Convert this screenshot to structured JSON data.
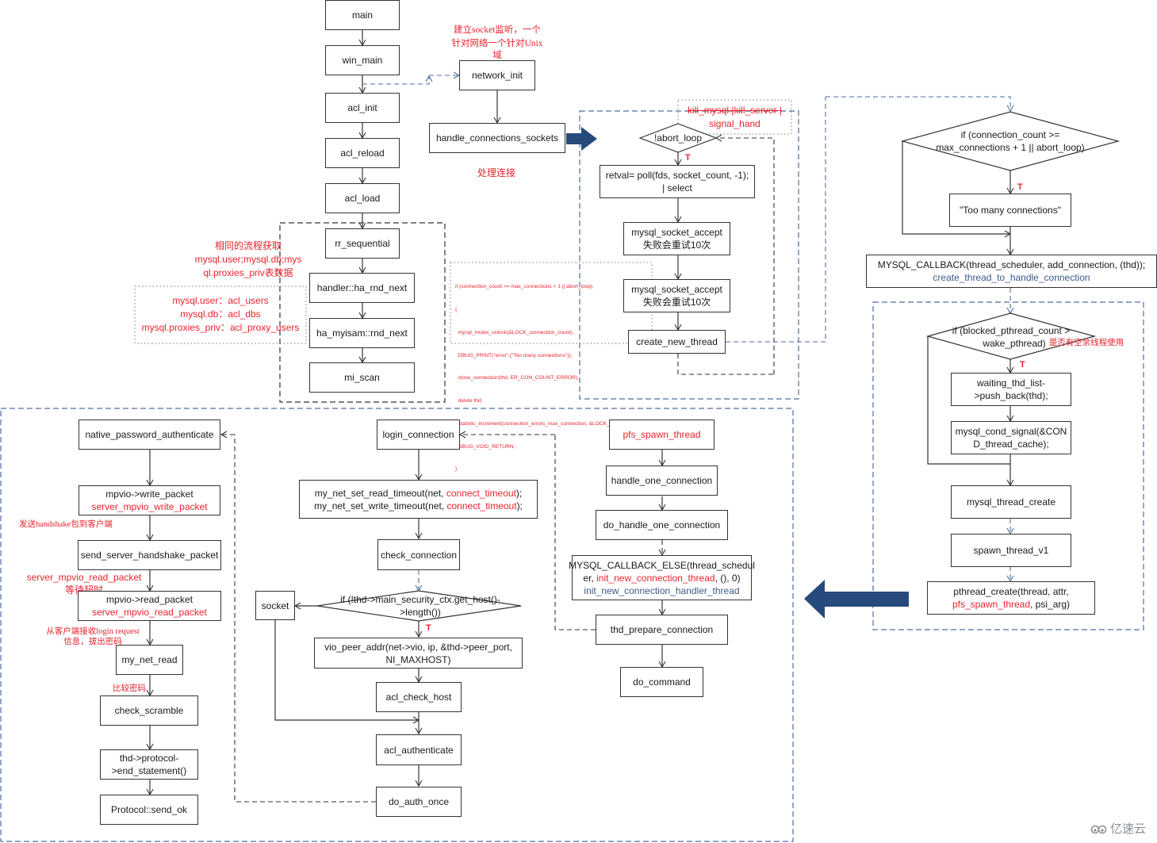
{
  "colors": {
    "text": "#1a1a1a",
    "red": "#e8232d",
    "blue": "#3b5b86",
    "arrow": "#264a7c",
    "line": "#333333",
    "group_border_blue": "#4f6fa0"
  },
  "startup": {
    "main": "main",
    "win_main": "win_main",
    "acl_init": "acl_init",
    "acl_reload": "acl_reload",
    "acl_load": "acl_load",
    "rr_sequential": "rr_sequential",
    "ha_rnd_next": "handler::ha_rnd_next",
    "rnd_next": "ha_myisam::rnd_next",
    "mi_scan": "mi_scan",
    "network_init": "network_init",
    "handle_connections_sockets": "handle_connections_sockets"
  },
  "notes": {
    "network_init_note": [
      "建立socket监听，一个",
      "针对网络一个针对Unix",
      "域"
    ],
    "handle_note": "处理连接",
    "acl_same_flow": [
      "相同的流程获取",
      "mysql.user;mysql.db;mys",
      "ql.proxies_priv表数据"
    ],
    "acl_mapping": [
      "mysql.user：acl_users",
      "mysql.db：acl_dbs",
      "mysql.proxies_priv：acl_proxy_users"
    ],
    "kill_note_line1": "kill_mysql |kill_server |",
    "kill_note_line2": "signal_hand",
    "code_snippet": [
      "if (connection_count >= max_connections + 1 || abort_loop)",
      "{",
      "  mysql_mutex_unlock(&LOCK_connection_count);",
      "  DBUG_PRINT(\"error\",(\"Too many connections\"));",
      "  close_connection(thd, ER_CON_COUNT_ERROR);",
      "  delete thd;",
      "  statistic_increment(connection_errors_max_connection, &LOCK_status);",
      "  DBUG_VOID_RETURN;",
      "}"
    ],
    "idle_thread_note": "是否有空余线程使用",
    "send_handshake_note": "发送handshake包到客户端",
    "read_packet_blue": "server_mpvio_read_packet",
    "read_packet_wait": "等待超时",
    "recv_login_note": [
      "从客户端接收login request",
      "信息，拔出密码"
    ],
    "compare_pwd_note": "比较密码"
  },
  "loop": {
    "abort_loop": "!abort_loop",
    "t_label": "T",
    "poll": [
      "retval= poll(fds, socket_count, -1);",
      "| select"
    ],
    "accept1": [
      "mysql_socket_accept",
      "失败会重试10次"
    ],
    "accept2": [
      "mysql_socket_accept",
      "失败会重试10次"
    ],
    "create_new_thread": "create_new_thread"
  },
  "scheduler": {
    "cond": [
      "if (connection_count >=",
      "max_connections + 1 || abort_loop)"
    ],
    "too_many": "\"Too many connections\"",
    "callback_line1": "MYSQL_CALLBACK(thread_scheduler, add_connection, (thd));",
    "callback_line2": "create_thread_to_handle_connection",
    "blocked_cond": [
      "if (blocked_pthread_count >",
      "wake_pthread)"
    ],
    "push_back": [
      "waiting_thd_list-",
      ">push_back(thd);"
    ],
    "cond_signal": [
      "mysql_cond_signal(&CON",
      "D_thread_cache);"
    ],
    "thread_create": "mysql_thread_create",
    "spawn_v1": "spawn_thread_v1",
    "pthread_create_a": "pthread_create(thread, attr,",
    "pthread_create_red": "pfs_spawn_thread",
    "pthread_create_b": ", psi_arg)"
  },
  "thread": {
    "pfs_spawn_thread": "pfs_spawn_thread",
    "handle_one": "handle_one_connection",
    "do_handle_one": "do_handle_one_connection",
    "cb_else_a": "MYSQL_CALLBACK_ELSE(thread_schedul",
    "cb_else_b1": "er, ",
    "cb_else_b_red": "init_new_connection_thread",
    "cb_else_b2": ", (), 0)",
    "cb_else_c": "init_new_connection_handler_thread",
    "thd_prepare": "thd_prepare_connection",
    "do_command": "do_command"
  },
  "login": {
    "login_connection": "login_connection",
    "timeout_read_a": "my_net_set_read_timeout(net, ",
    "timeout_write_a": "my_net_set_write_timeout(net, ",
    "timeout_red": "connect_timeout",
    "timeout_end": ");",
    "check_connection": "check_connection",
    "host_cond": [
      "if (!thd->main_security_ctx.get_host()-",
      ">length())"
    ],
    "socket": "socket",
    "vio_peer": [
      "vio_peer_addr(net->vio, ip, &thd->peer_port,",
      "NI_MAXHOST)"
    ],
    "acl_check_host": "acl_check_host",
    "acl_authenticate": "acl_authenticate",
    "do_auth_once": "do_auth_once"
  },
  "auth": {
    "native": "native_password_authenticate",
    "write_packet": "mpvio->write_packet",
    "write_packet_red": "server_mpvio_write_packet",
    "send_handshake": "send_server_handshake_packet",
    "read_packet": "mpvio->read_packet",
    "read_packet_red": "server_mpvio_read_packet",
    "my_net_read": "my_net_read",
    "check_scramble": "check_scramble",
    "end_statement": [
      "thd->protocol-",
      ">end_statement()"
    ],
    "send_ok": "Protocol::send_ok"
  },
  "watermark": {
    "icon": "cloud-logo-icon",
    "text": "亿速云"
  }
}
